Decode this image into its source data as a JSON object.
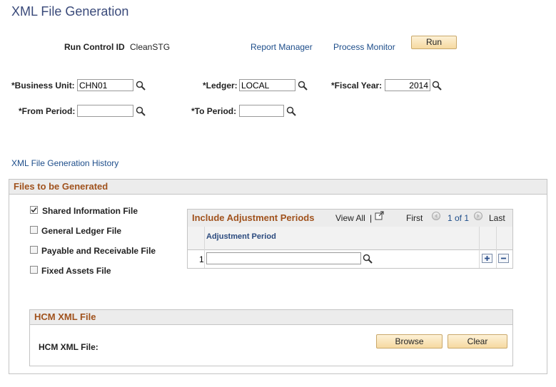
{
  "page": {
    "title": "XML File Generation"
  },
  "header": {
    "run_control_label": "Run Control ID",
    "run_control_value": "CleanSTG",
    "report_manager": "Report Manager",
    "process_monitor": "Process Monitor",
    "run_button": "Run"
  },
  "fields": {
    "business_unit_label": "*Business Unit:",
    "business_unit_value": "CHN01",
    "ledger_label": "*Ledger:",
    "ledger_value": "LOCAL",
    "fiscal_year_label": "*Fiscal Year:",
    "fiscal_year_value": "2014",
    "from_period_label": "*From Period:",
    "from_period_value": "",
    "to_period_label": "*To Period:",
    "to_period_value": ""
  },
  "history_link": "XML File Generation History",
  "files_section": {
    "title": "Files to be Generated",
    "checkboxes": [
      {
        "label": "Shared Information File",
        "checked": true
      },
      {
        "label": "General Ledger File",
        "checked": false
      },
      {
        "label": "Payable and Receivable File",
        "checked": false
      },
      {
        "label": "Fixed Assets File",
        "checked": false
      }
    ]
  },
  "grid": {
    "title": "Include Adjustment Periods",
    "view_all": "View All",
    "separator": "|",
    "first": "First",
    "range": "1 of 1",
    "last": "Last",
    "column_header": "Adjustment Period",
    "rows": [
      {
        "num": "1",
        "value": ""
      }
    ]
  },
  "hcm_section": {
    "title": "HCM XML File",
    "label": "HCM XML File:",
    "browse_button": "Browse",
    "clear_button": "Clear"
  },
  "colors": {
    "section_title": "#a0521d",
    "link": "#1d4d8a",
    "page_title": "#3a4a7a"
  },
  "icons": [
    "lookup-icon",
    "checkmark-icon",
    "new-window-icon",
    "arrow-left-icon",
    "arrow-right-icon",
    "plus-icon",
    "minus-icon"
  ]
}
